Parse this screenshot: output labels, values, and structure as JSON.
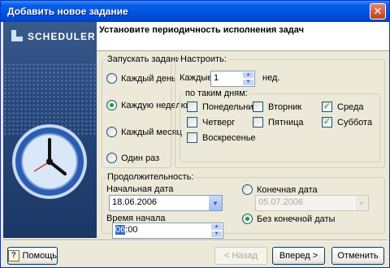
{
  "window": {
    "title": "Добавить новое задание",
    "close_label": "✕"
  },
  "brand": {
    "logo_text": "SCHEDULER"
  },
  "header": {
    "instruction": "Установите периодичность исполнения задач"
  },
  "run": {
    "group_label": "Запускать задание:",
    "options": [
      "Каждый день",
      "Каждую неделю",
      "Каждый месяц",
      "Один раз"
    ],
    "selected": "Каждую неделю"
  },
  "settings": {
    "group_label": "Настроить:",
    "every_label": "Каждые",
    "every_value": "1",
    "unit_label": "нед.",
    "days_group_label": "по таким дням:",
    "days": [
      {
        "label": "Понедельник",
        "checked": false
      },
      {
        "label": "Вторник",
        "checked": false
      },
      {
        "label": "Среда",
        "checked": true
      },
      {
        "label": "Четверг",
        "checked": false
      },
      {
        "label": "Пятница",
        "checked": false
      },
      {
        "label": "Суббота",
        "checked": true
      },
      {
        "label": "Воскресенье",
        "checked": false
      }
    ]
  },
  "duration": {
    "group_label": "Продолжительность:",
    "start_date_label": "Начальная дата",
    "start_date_value": "18.06.2006",
    "start_time_label": "Время начала",
    "start_time_hours": "06",
    "start_time_rest": ":00",
    "end_date_option": "Конечная дата",
    "end_date_value": "05.07.2006",
    "no_end_option": "Без конечной даты",
    "end_selected": "Без конечной даты"
  },
  "footer": {
    "help_label": "Помощь",
    "back_label": "< Назад",
    "next_label": "Вперед >",
    "cancel_label": "Отменить"
  },
  "colors": {
    "title_bar": "#0054e3",
    "panel": "#ece9d8",
    "accent_check": "#21a121"
  }
}
